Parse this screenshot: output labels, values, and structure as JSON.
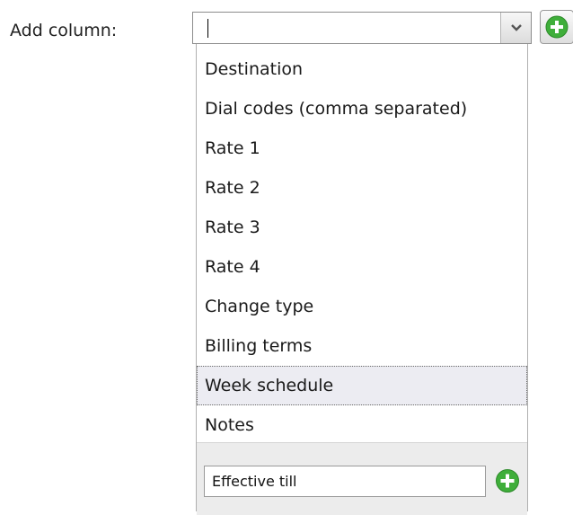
{
  "form": {
    "label": "Add column:",
    "combo_value": ""
  },
  "dropdown": {
    "items": [
      {
        "label": "Destination"
      },
      {
        "label": "Dial codes (comma separated)"
      },
      {
        "label": "Rate 1"
      },
      {
        "label": "Rate 2"
      },
      {
        "label": "Rate 3"
      },
      {
        "label": "Rate 4"
      },
      {
        "label": "Change type"
      },
      {
        "label": "Billing terms"
      },
      {
        "label": "Week schedule"
      },
      {
        "label": "Notes"
      }
    ],
    "highlighted_item": "Week schedule",
    "footer_input_value": "Effective till"
  },
  "icons": {
    "combo_button": "chevron-down-icon",
    "add_button": "plus-circle-icon",
    "footer_add_button": "plus-circle-icon"
  },
  "colors": {
    "add_icon_green": "#3fae3a",
    "highlight_bg": "#ececf2"
  }
}
